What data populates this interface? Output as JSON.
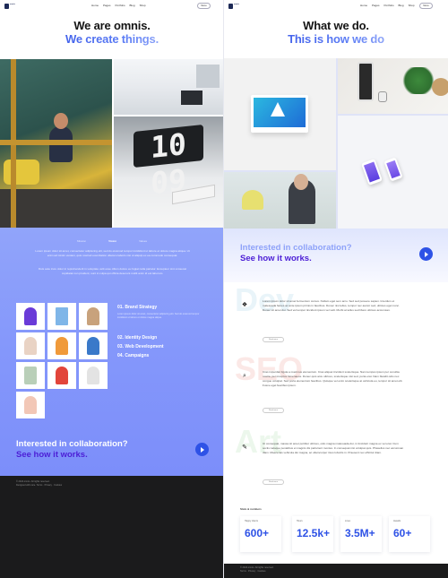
{
  "left": {
    "nav": {
      "brand": "omnis",
      "links": [
        "Home",
        "Pages",
        "Portfolio",
        "Blog",
        "Shop"
      ],
      "icons": [
        "search",
        "cart"
      ],
      "menu_label": "Menu"
    },
    "hero": {
      "line1": "We are omnis.",
      "line2": "We create things."
    },
    "tabs": [
      "Mission",
      "Vision",
      "Values"
    ],
    "para1": "Lorem ipsum dolor sit amet, consectetur adipiscing elit, sed do eiusmod tempor incididunt ut labore et dolore magna aliqua. Ut enim ad minim veniam, quis nostrud exercitation ullamco laboris nisi ut aliquip ex ea commodo consequat.",
    "para2": "Duis aute irure dolor in reprehenderit in voluptate velit esse cillum dolore eu fugiat nulla pariatur. Excepteur sint occaecat cupidatat non proident, sunt in culpa qui officia deserunt mollit anim id est laborum.",
    "services": [
      {
        "label": "01. Brand Strategy"
      },
      {
        "label": "02. Identity Design"
      },
      {
        "label": "03. Web Development"
      },
      {
        "label": "04. Campaigns"
      }
    ],
    "service_desc": "Lorem ipsum dolor sit amet, consectetur adipiscing elit. Sed do eiusmod tempor incididunt ut labore et dolore magna aliqua.",
    "cta": {
      "line1": "Interested in collaboration?",
      "line2": "See how it works."
    },
    "footer": {
      "line1": "© 2024 omnis. All rights reserved.",
      "line2": "Designed with care. Terms · Privacy · Cookies"
    }
  },
  "right": {
    "nav": {
      "brand": "omnis",
      "links": [
        "Home",
        "Pages",
        "Portfolio",
        "Blog",
        "Shop"
      ],
      "menu_label": "Menu"
    },
    "hero": {
      "line1": "What we do.",
      "line2": "This is how we do"
    },
    "cta": {
      "line1": "Interested in collaboration?",
      "line2": "See how it works."
    },
    "service_blocks": [
      {
        "big": "Dev",
        "icon": "❖",
        "text": "Lorem ipsum dolor sit amet fermentum cursus. Nullam eget sem arcu. Sed sed posuere sapien. Interdum et malesuada fames ac ante ipsum primis in faucibus. Donec nisi tellus, tempor nec auctor sed, ultrices eget nunc. Donec sit amet dui. Sed vel tempor tincidunt ipsum vel velit. Morbi at tellus sed libero ultrices accumsan.",
        "more": "Read more"
      },
      {
        "big": "SEO",
        "icon": "⌕",
        "text": "Cras imperdiet ligula a maximus elementum. Cras aliquet tincidunt scelerisque. Nam tempus ipsum per conubia nostra, per inceptos himenaeos. Donec quis arcu ultrices, scelerisque nisi sed, porta erat. Nam blandit odio nec congue volutpat. Sed porta elementum faucibus. Quisque vel enim scelerisque at vehicula eu, tempor sit amet elit. Fusce eget faucibus ipsum.",
        "more": "Read more"
      },
      {
        "big": "Art",
        "icon": "✎",
        "text": "Ut consequat, massa sit amet porttitor ultrices, odio magna malesuada dui, in tincidunt magna ex vel erat. Cum sociis natoque penatibus et magnis dis parturient montes. In consequat nisi volutpat quis. Phasellus nec accumsan diam. Maecenas vehicula dui magna, ac ullamcorper risus lobortis in. Praesent nec efficitur diam.",
        "more": "Read more"
      }
    ],
    "stats_title": "Stats & numbers",
    "stats": [
      {
        "label": "Happy clients",
        "value": "600+"
      },
      {
        "label": "Hours",
        "value": "12.5k+"
      },
      {
        "label": "Lines",
        "value": "3.5M+"
      },
      {
        "label": "Awards",
        "value": "60+"
      }
    ],
    "footer": {
      "line1": "© 2024 omnis. All rights reserved.",
      "line2": "Terms · Privacy · Cookies"
    }
  }
}
